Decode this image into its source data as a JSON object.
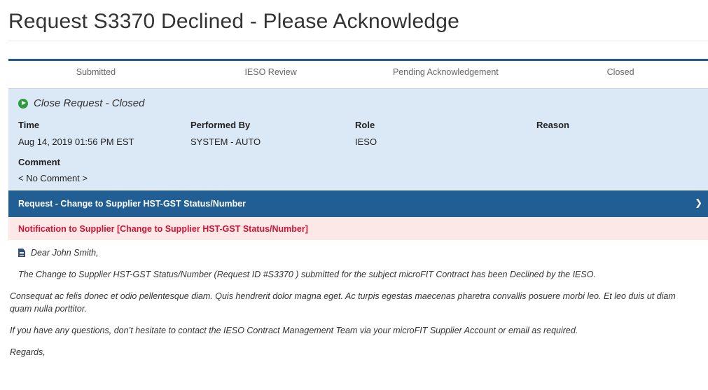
{
  "page": {
    "title": "Request S3370 Declined - Please Acknowledge"
  },
  "stepper": {
    "steps": [
      "Submitted",
      "IESO Review",
      "Pending Acknowledgement",
      "Closed"
    ]
  },
  "history": {
    "title": "Close Request - Closed",
    "icon": "play-circle-icon",
    "columns": {
      "time_label": "Time",
      "performed_by_label": "Performed By",
      "role_label": "Role",
      "reason_label": "Reason"
    },
    "values": {
      "time": "Aug 14, 2019 01:56 PM  EST",
      "performed_by": "SYSTEM - AUTO",
      "role": "IESO",
      "reason": ""
    },
    "comment_label": "Comment",
    "comment_value": "< No Comment >"
  },
  "request_bar": {
    "label": "Request - Change to Supplier HST-GST Status/Number",
    "icon": "chevron-right-icon"
  },
  "notification": {
    "label": "Notification to Supplier [Change to Supplier HST-GST Status/Number]"
  },
  "letter": {
    "greeting": "Dear John Smith,",
    "paragraph_1": "The Change to Supplier HST-GST Status/Number (Request ID #S3370 ) submitted for the subject microFIT Contract has been Declined by the IESO.",
    "paragraph_2": "Consequat ac felis donec et odio pellentesque diam. Quis hendrerit dolor magna eget. Ac turpis egestas maecenas pharetra convallis posuere morbi leo. Et leo duis ut diam quam nulla porttitor.",
    "paragraph_3": "If you have any questions, don’t hesitate to contact the IESO Contract Management Team via your microFIT Supplier Account or email as required.",
    "closing": "Regards,"
  },
  "colors": {
    "stepper_rule": "#1f5b8f",
    "history_bg": "#dbe8f6",
    "request_bar_bg": "#215e94",
    "notification_bg": "#fde8e8",
    "notification_text": "#d01534",
    "status_icon": "#2e9c3d"
  }
}
